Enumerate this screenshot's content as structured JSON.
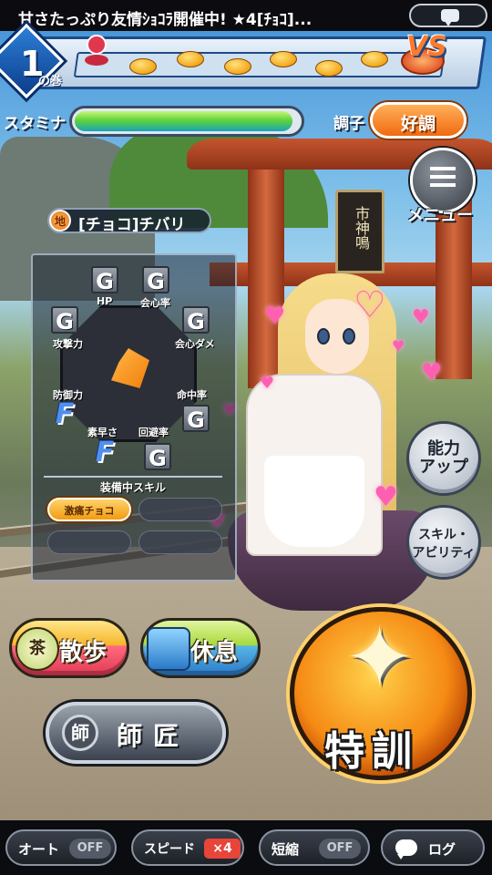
{
  "banner": {
    "text": "甘さたっぷり友情ｼｮｺﾗ開催中! ★4[ﾁｮｺ]..."
  },
  "progress": {
    "chapter_number": "1",
    "chapter_label": "の巻",
    "goal_label": "VS"
  },
  "stamina": {
    "label": "スタミナ",
    "fill_fraction": 0.97
  },
  "condition": {
    "label": "調子",
    "value": "好調"
  },
  "character": {
    "element": "地",
    "name": "[チョコ]チバリ"
  },
  "shrine": {
    "plaque": "市神鳴"
  },
  "stats": {
    "hp": {
      "label": "HP",
      "grade": "G"
    },
    "crit": {
      "label": "会心率",
      "grade": "G"
    },
    "crit_damage": {
      "label": "会心ダメ",
      "grade": "G"
    },
    "attack": {
      "label": "攻撃力",
      "grade": "G"
    },
    "defense": {
      "label": "防御力",
      "grade": "F"
    },
    "accuracy": {
      "label": "命中率",
      "grade": "G"
    },
    "speed": {
      "label": "素早さ",
      "grade": "F"
    },
    "evasion": {
      "label": "回避率",
      "grade": "G"
    }
  },
  "skills": {
    "header": "装備中スキル",
    "slots": [
      "激痛チョコ",
      "",
      "",
      ""
    ]
  },
  "right_menu": {
    "menu_label": "メニュー",
    "ability_label": "能力\nアップ",
    "skill_label": "スキル・\nアビリティ"
  },
  "actions": {
    "walk": {
      "icon_text": "茶",
      "label": "散歩"
    },
    "rest": {
      "label": "休息"
    },
    "master": {
      "seal": "師",
      "label": "師匠"
    },
    "train": {
      "label": "特訓"
    }
  },
  "toolbar": {
    "auto": {
      "label": "オート",
      "state": "OFF"
    },
    "speed": {
      "label": "スピード",
      "multiplier": "×4"
    },
    "shorten": {
      "label": "短縮",
      "state": "OFF"
    },
    "log": {
      "label": "ログ"
    }
  }
}
